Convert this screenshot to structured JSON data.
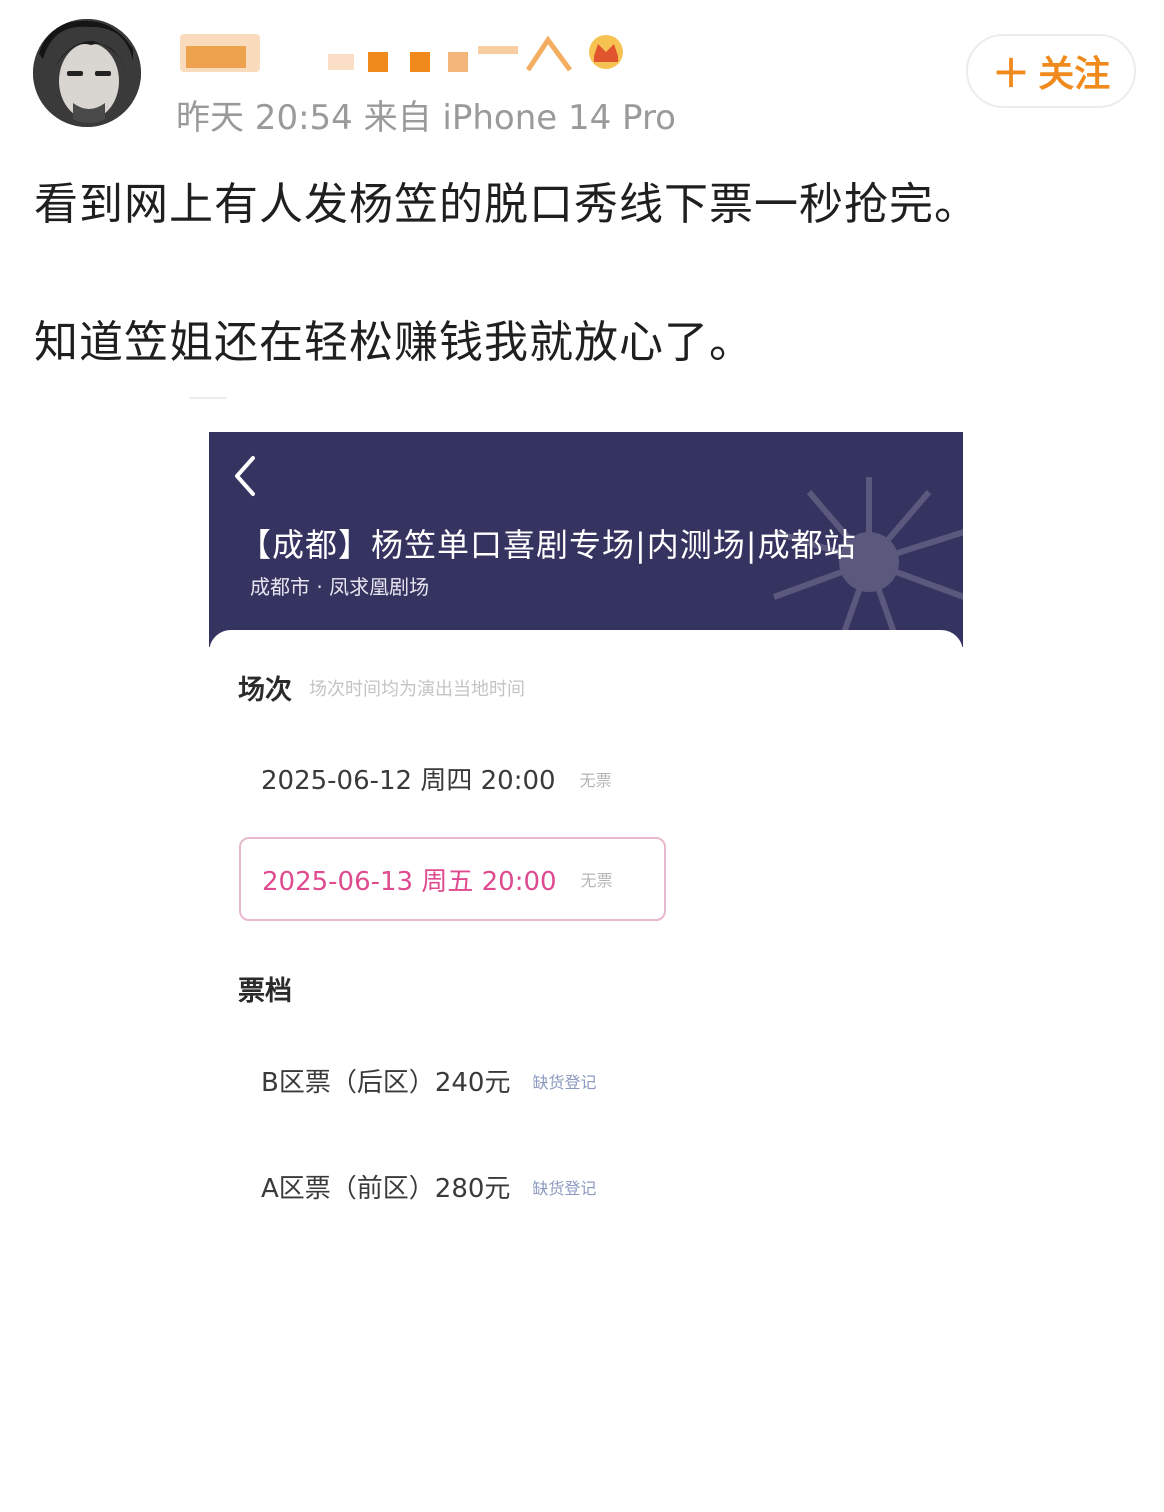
{
  "post": {
    "meta": "昨天 20:54 来自 iPhone 14 Pro",
    "follow_label": "关注",
    "text_lines": [
      "看到网上有人发杨笠的脱口秀线下票一秒抢完。",
      "知道笠姐还在轻松赚钱我就放心了。"
    ]
  },
  "screenshot": {
    "title": "【成都】杨笠单口喜剧专场|内测场|成都站",
    "venue": "成都市 · 凤求凰剧场",
    "session_section": {
      "label": "场次",
      "note": "场次时间均为演出当地时间",
      "options": [
        {
          "text": "2025-06-12 周四 20:00",
          "status": "无票",
          "selected": false
        },
        {
          "text": "2025-06-13 周五 20:00",
          "status": "无票",
          "selected": true
        }
      ]
    },
    "tier_section": {
      "label": "票档",
      "options": [
        {
          "text": "B区票（后区）240元",
          "status": "缺货登记"
        },
        {
          "text": "A区票（前区）280元",
          "status": "缺货登记"
        }
      ]
    }
  },
  "colors": {
    "follow_orange": "#f08a1c",
    "header_navy": "#35335f",
    "selected_pink": "#de4b8f"
  }
}
